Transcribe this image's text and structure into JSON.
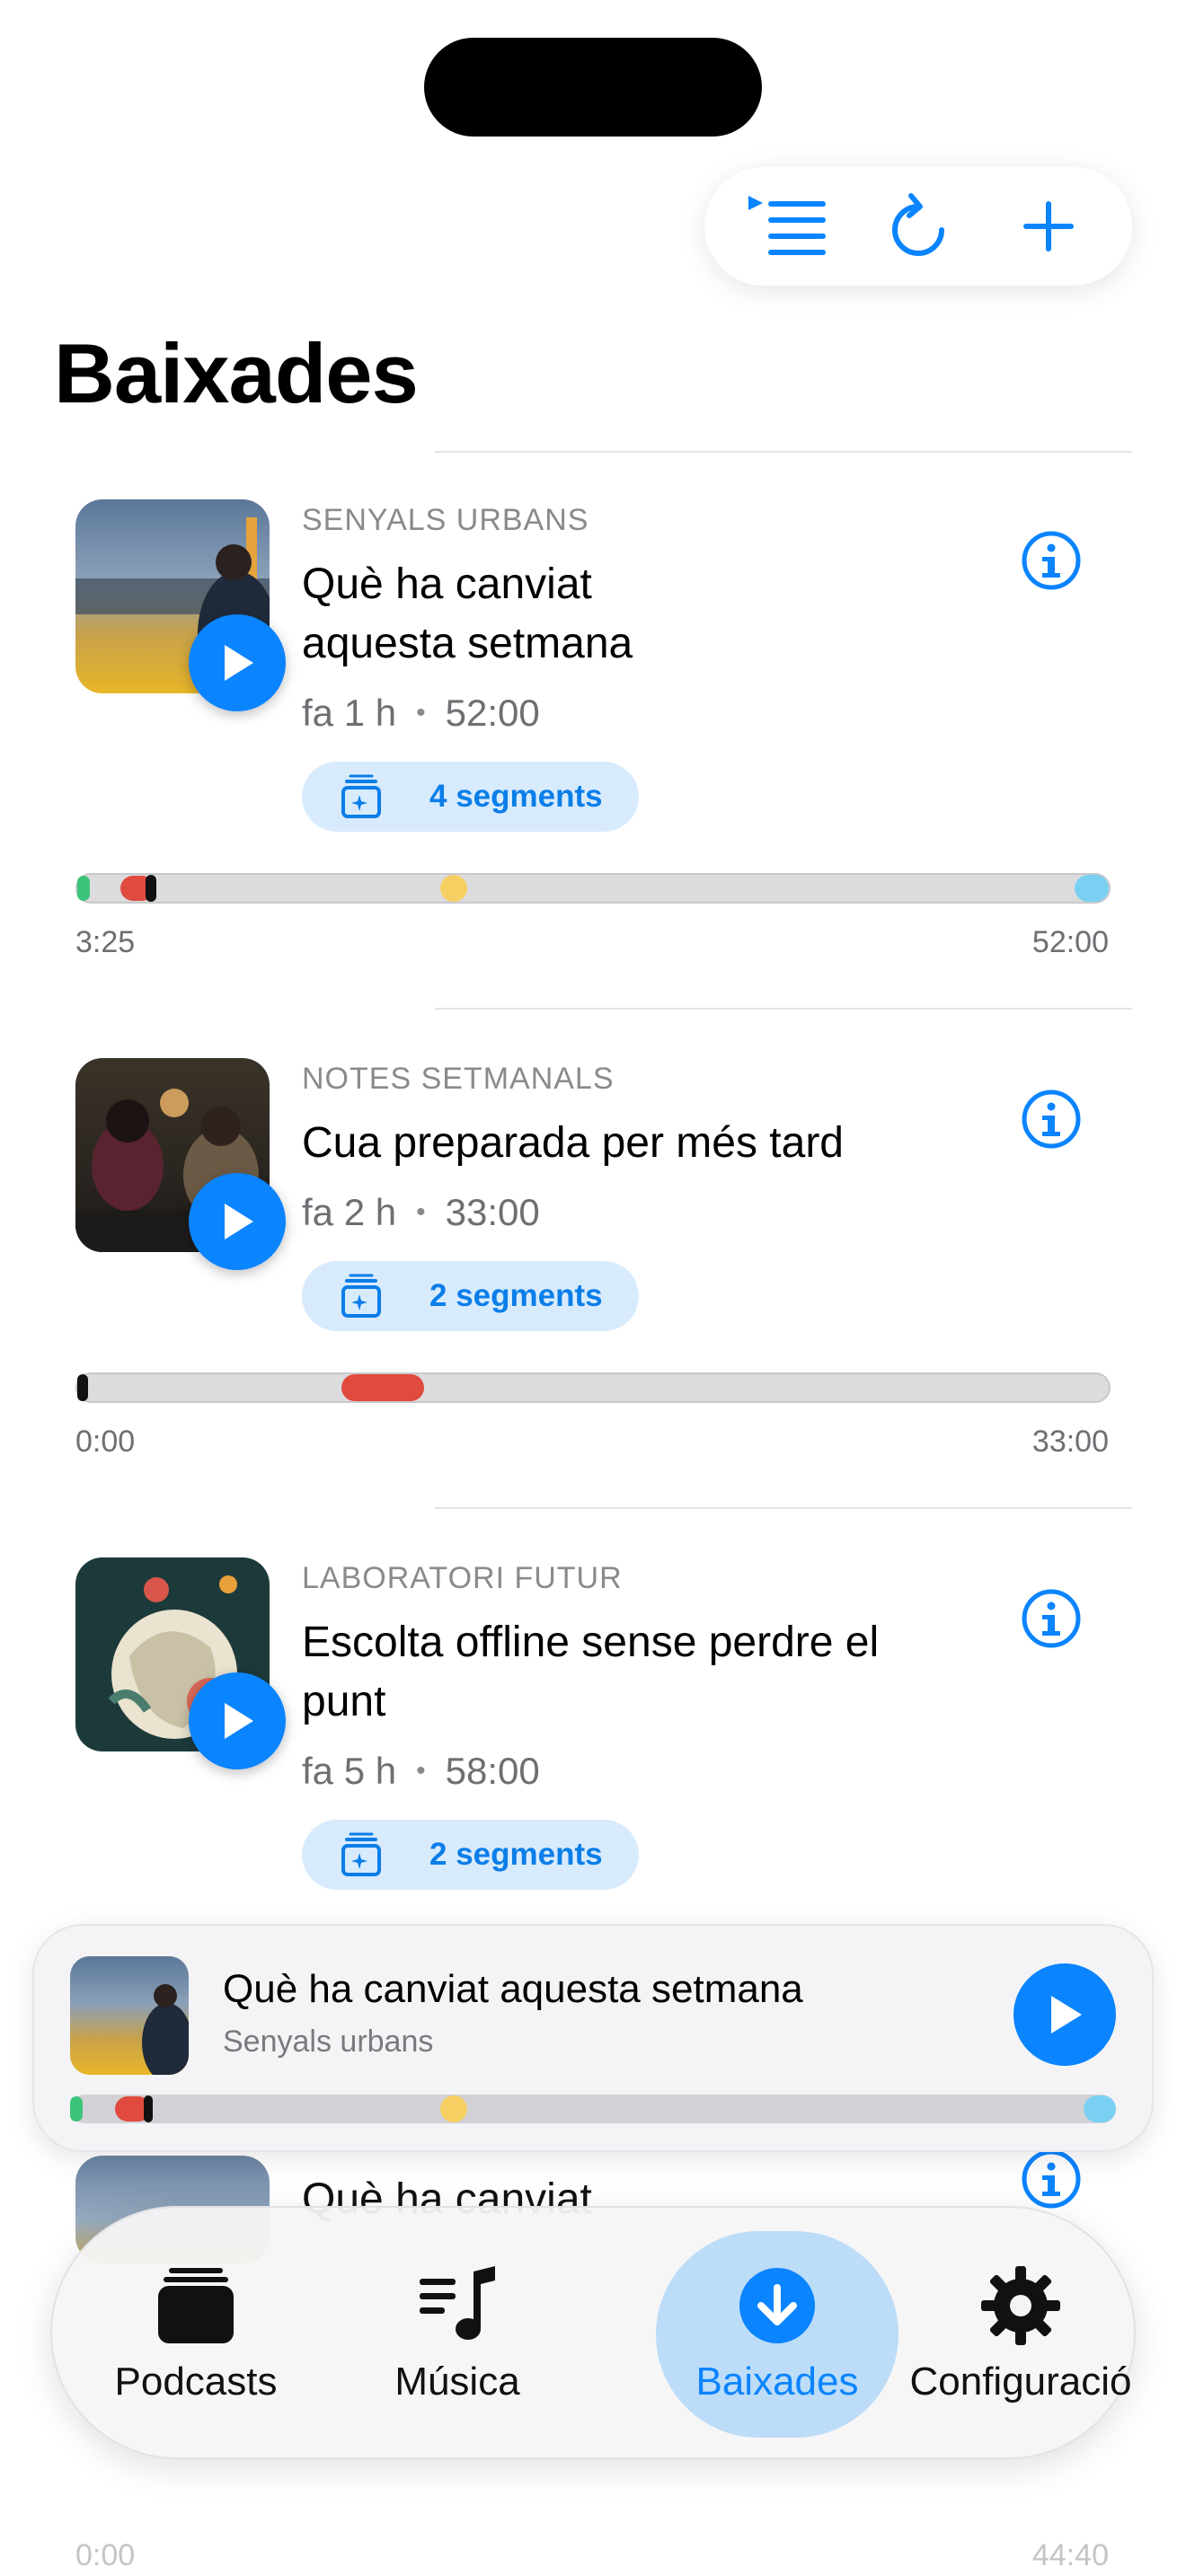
{
  "colors": {
    "accent": "#0a84ff",
    "pill_bg": "#d8ebfd",
    "track": "#dcdcde"
  },
  "toolbar": {
    "icons": [
      "queue-list-icon",
      "refresh-icon",
      "plus-icon"
    ]
  },
  "page": {
    "title": "Baixades"
  },
  "episodes": [
    {
      "show": "SENYALS URBANS",
      "title": "Què ha canviat aquesta setmana",
      "age": "fa 1 h",
      "duration": "52:00",
      "segments": "4 segments",
      "position": "3:25",
      "end": "52:00",
      "progress_markers": [
        "green-start",
        "red",
        "black-playhead",
        "yellow",
        "light-blue-end"
      ]
    },
    {
      "show": "NOTES SETMANALS",
      "title": "Cua preparada per més tard",
      "age": "fa 2 h",
      "duration": "33:00",
      "segments": "2 segments",
      "position": "0:00",
      "end": "33:00",
      "progress_markers": [
        "black-playhead",
        "red"
      ]
    },
    {
      "show": "LABORATORI FUTUR",
      "title": "Escolta offline sense perdre el punt",
      "age": "fa 5 h",
      "duration": "58:00",
      "segments": "2 segments"
    },
    {
      "title_partial": "Què ha canviat",
      "position": "0:00",
      "end": "44:40"
    }
  ],
  "mini_player": {
    "title": "Què ha canviat aquesta setmana",
    "subtitle": "Senyals urbans"
  },
  "tabbar": {
    "tabs": [
      {
        "label": "Podcasts",
        "icon": "podcasts-stack-icon",
        "active": false
      },
      {
        "label": "Música",
        "icon": "music-note-list-icon",
        "active": false
      },
      {
        "label": "Baixades",
        "icon": "download-circle-icon",
        "active": true
      },
      {
        "label": "Configuració",
        "icon": "gear-icon",
        "active": false
      }
    ]
  }
}
